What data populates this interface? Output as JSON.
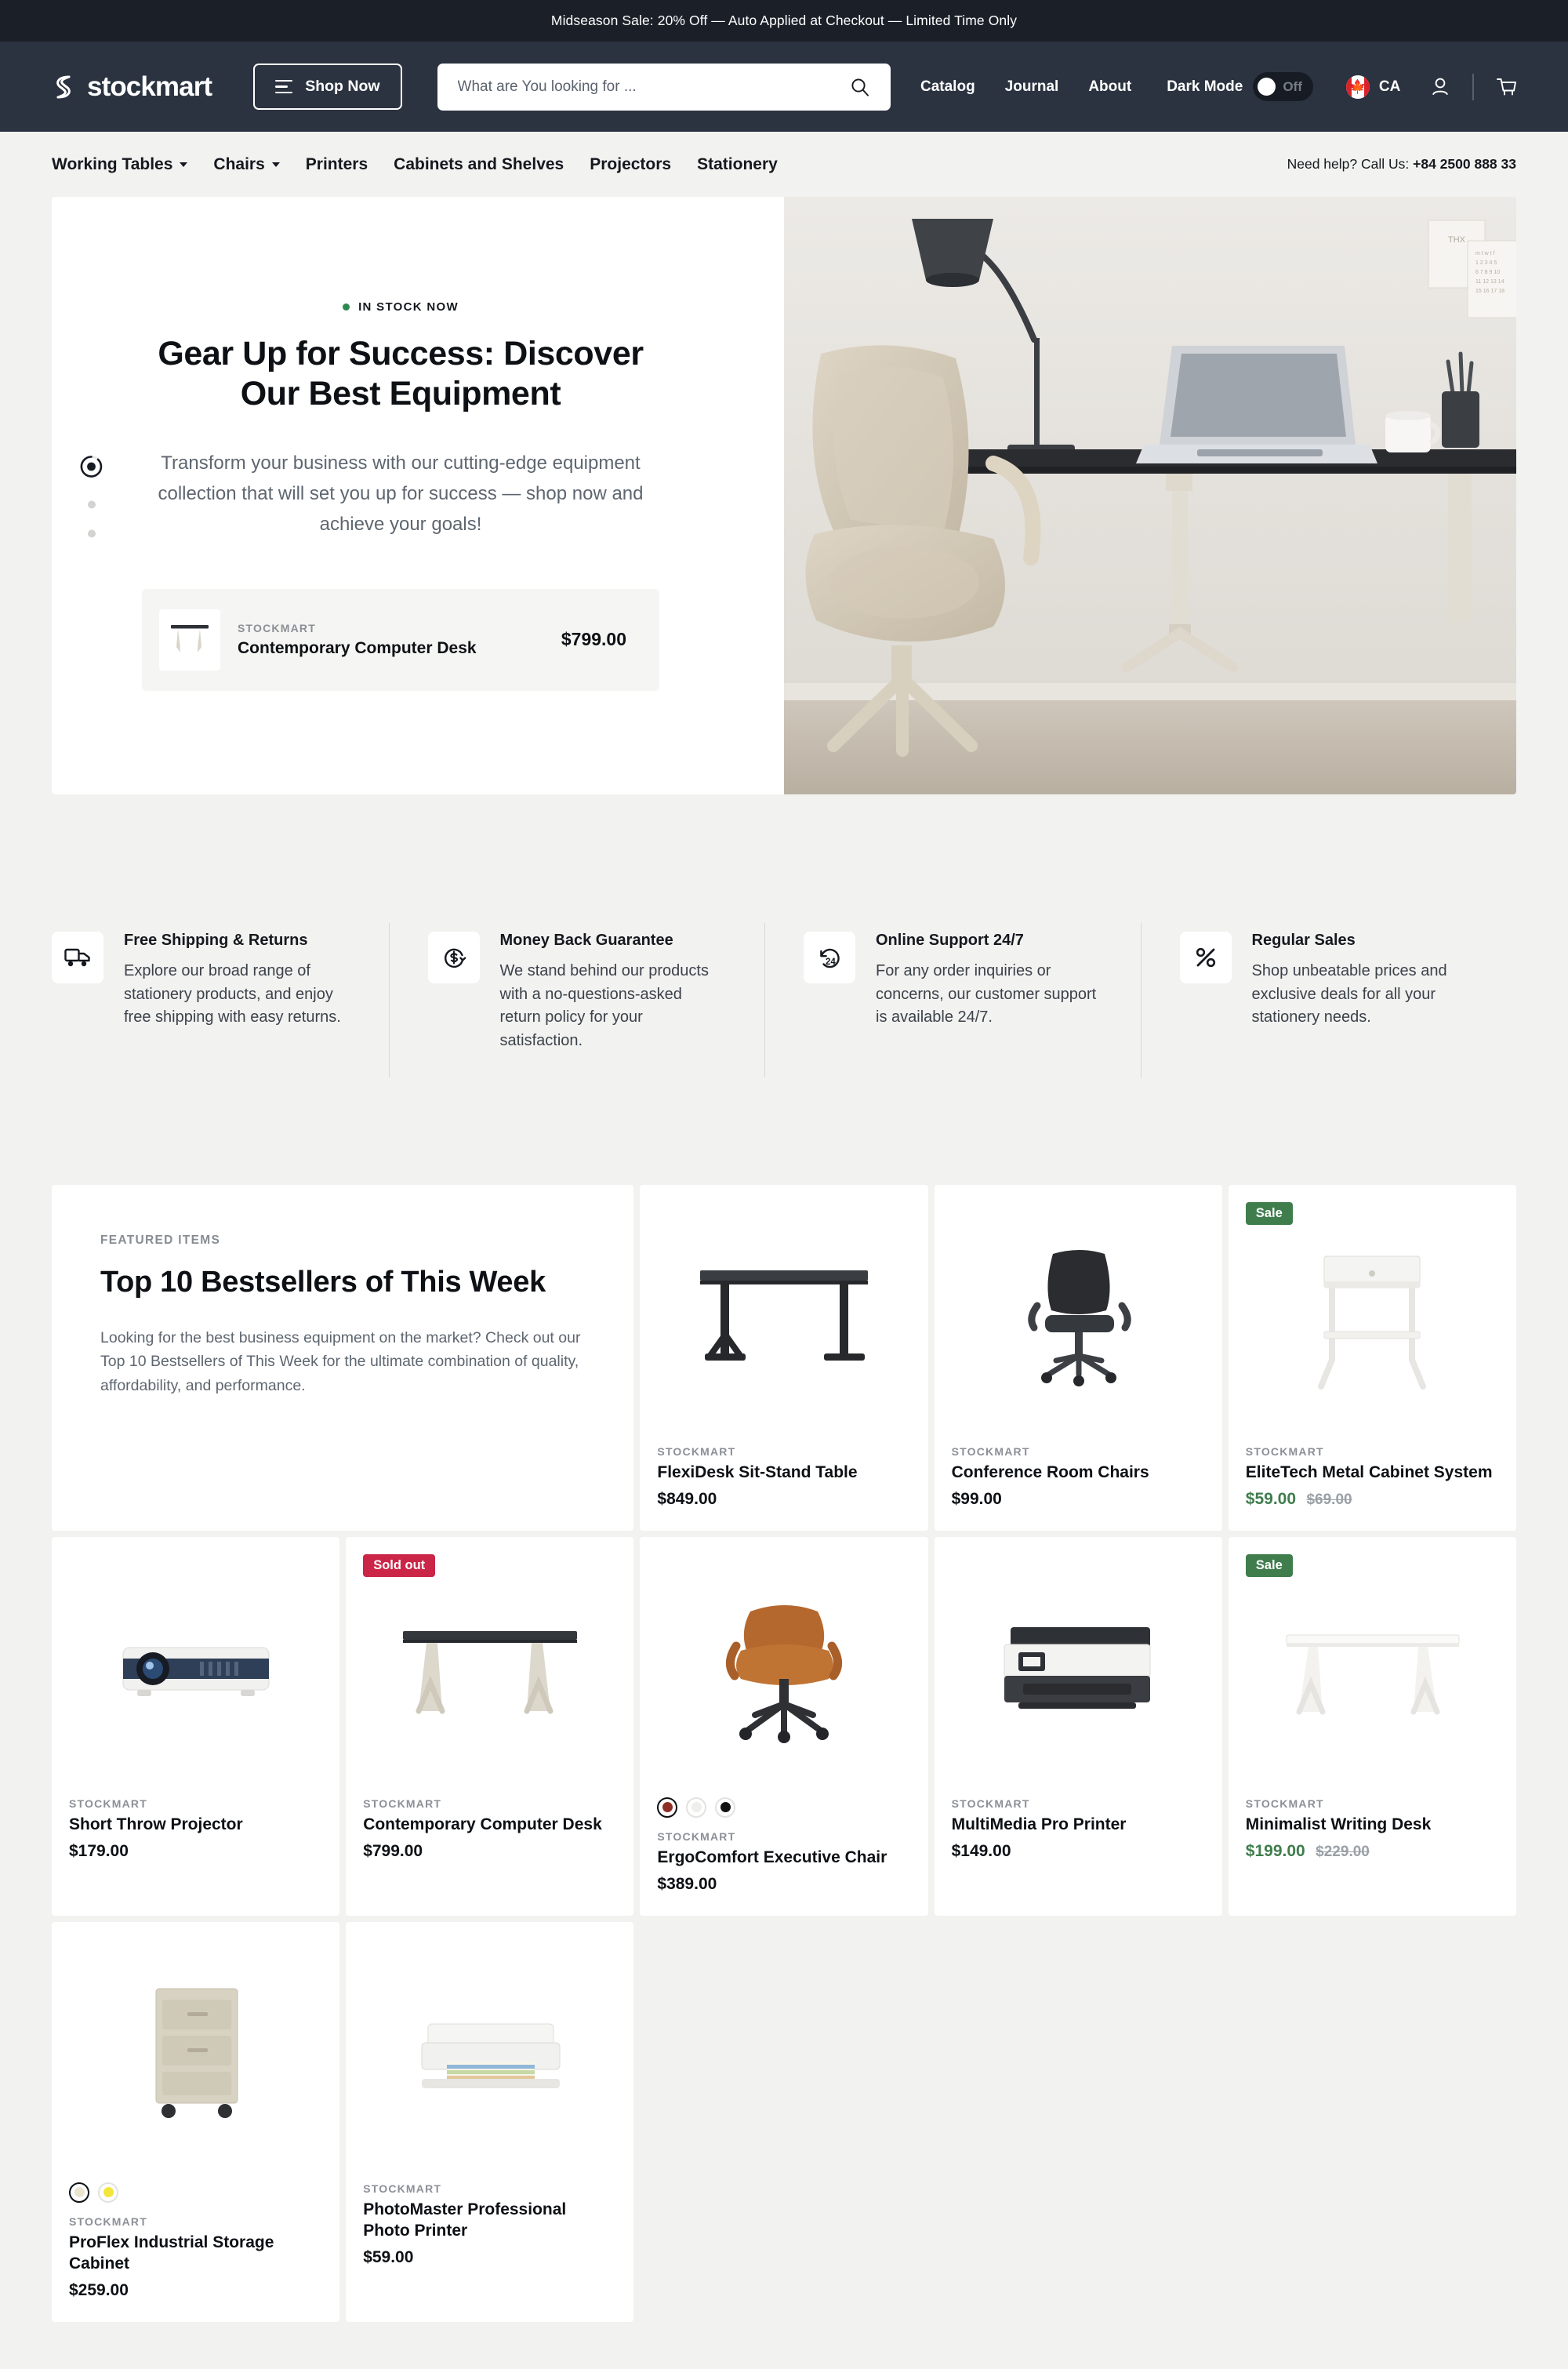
{
  "announcement": {
    "text": "Midseason Sale: 20% Off — Auto Applied at Checkout — Limited Time Only"
  },
  "header": {
    "logo_text": "stockmart",
    "shop_now_label": "Shop Now",
    "search": {
      "placeholder": "What are You looking for ...",
      "value": ""
    },
    "nav": [
      {
        "label": "Catalog"
      },
      {
        "label": "Journal"
      },
      {
        "label": "About"
      }
    ],
    "dark_mode": {
      "label": "Dark Mode",
      "state": "Off"
    },
    "country": {
      "code": "CA",
      "flag": "canada-flag"
    },
    "icons": {
      "account": "account-icon",
      "cart": "cart-icon",
      "search": "search-icon"
    }
  },
  "catnav": {
    "items": [
      {
        "label": "Working Tables",
        "has_dropdown": true
      },
      {
        "label": "Chairs",
        "has_dropdown": true
      },
      {
        "label": "Printers",
        "has_dropdown": false
      },
      {
        "label": "Cabinets and Shelves",
        "has_dropdown": false
      },
      {
        "label": "Projectors",
        "has_dropdown": false
      },
      {
        "label": "Stationery",
        "has_dropdown": false
      }
    ],
    "help_prefix": "Need help? Call Us:",
    "help_phone": "+84 2500 888 33"
  },
  "hero": {
    "stock_label": "IN STOCK NOW",
    "title": "Gear Up for Success: Discover Our Best Equipment",
    "subtitle": "Transform your business with our cutting-edge equipment collection that will set you up for success — shop now and achieve your goals!",
    "product": {
      "vendor": "STOCKMART",
      "name": "Contemporary Computer Desk",
      "price": "$799.00"
    },
    "slides": 3,
    "active_slide": 1
  },
  "features": [
    {
      "icon": "truck-icon",
      "title": "Free Shipping & Returns",
      "desc": "Explore our broad range of stationery products, and enjoy free shipping with easy returns."
    },
    {
      "icon": "money-back-icon",
      "title": "Money Back Guarantee",
      "desc": "We stand behind our products with a no-questions-asked return policy for your satisfaction."
    },
    {
      "icon": "support-24-icon",
      "title": "Online Support 24/7",
      "desc": "For any order inquiries or concerns, our customer support is available 24/7."
    },
    {
      "icon": "percent-icon",
      "title": "Regular Sales",
      "desc": "Shop unbeatable prices and exclusive deals for all your stationery needs."
    }
  ],
  "bestsellers": {
    "eyebrow": "FEATURED ITEMS",
    "title": "Top 10 Bestsellers of This Week",
    "desc": "Looking for the best business equipment on the market? Check out our Top 10 Bestsellers of This Week for the ultimate combination of quality, affordability, and performance.",
    "products": [
      {
        "vendor": "STOCKMART",
        "name": "FlexiDesk Sit-Stand Table",
        "price": "$849.00",
        "compare": "",
        "badge": "",
        "on_sale": false,
        "image": "black-sit-stand-desk",
        "swatches": []
      },
      {
        "vendor": "STOCKMART",
        "name": "Conference Room Chairs",
        "price": "$99.00",
        "compare": "",
        "badge": "",
        "on_sale": false,
        "image": "black-mesh-office-chair",
        "swatches": []
      },
      {
        "vendor": "STOCKMART",
        "name": "EliteTech Metal Cabinet System",
        "price": "$59.00",
        "compare": "$69.00",
        "badge": "Sale",
        "on_sale": true,
        "image": "white-side-cabinet",
        "swatches": []
      },
      {
        "vendor": "STOCKMART",
        "name": "Short Throw Projector",
        "price": "$179.00",
        "compare": "",
        "badge": "",
        "on_sale": false,
        "image": "white-projector",
        "swatches": []
      },
      {
        "vendor": "STOCKMART",
        "name": "Contemporary Computer Desk",
        "price": "$799.00",
        "compare": "",
        "badge": "Sold out",
        "on_sale": false,
        "image": "beige-computer-desk",
        "swatches": []
      },
      {
        "vendor": "STOCKMART",
        "name": "ErgoComfort Executive Chair",
        "price": "$389.00",
        "compare": "",
        "badge": "",
        "on_sale": false,
        "image": "tan-leather-executive-chair",
        "swatches": [
          {
            "color": "#8e2f25",
            "selected": true
          },
          {
            "color": "#eeeeec",
            "selected": false
          },
          {
            "color": "#121212",
            "selected": false
          }
        ]
      },
      {
        "vendor": "STOCKMART",
        "name": "MultiMedia Pro Printer",
        "price": "$149.00",
        "compare": "",
        "badge": "",
        "on_sale": false,
        "image": "black-white-multifunction-printer",
        "swatches": []
      },
      {
        "vendor": "STOCKMART",
        "name": "Minimalist Writing Desk",
        "price": "$199.00",
        "compare": "$229.00",
        "badge": "Sale",
        "on_sale": true,
        "image": "white-writing-desk",
        "swatches": []
      },
      {
        "vendor": "STOCKMART",
        "name": "ProFlex Industrial Storage Cabinet",
        "price": "$259.00",
        "compare": "",
        "badge": "",
        "on_sale": false,
        "image": "beige-rolling-storage-cabinet",
        "swatches": [
          {
            "color": "#e8e6d0",
            "selected": true
          },
          {
            "color": "#f2e63c",
            "selected": false
          }
        ]
      },
      {
        "vendor": "STOCKMART",
        "name": "PhotoMaster Professional Photo Printer",
        "price": "$59.00",
        "compare": "",
        "badge": "",
        "on_sale": false,
        "image": "white-photo-printer",
        "swatches": []
      }
    ]
  },
  "colors": {
    "header_bg": "#2b3340",
    "announce_bg": "#1b2028",
    "page_bg": "#f2f2f0",
    "sale_green": "#3f7d4d",
    "sold_red": "#cb2547",
    "stock_green": "#2d8a4e"
  }
}
